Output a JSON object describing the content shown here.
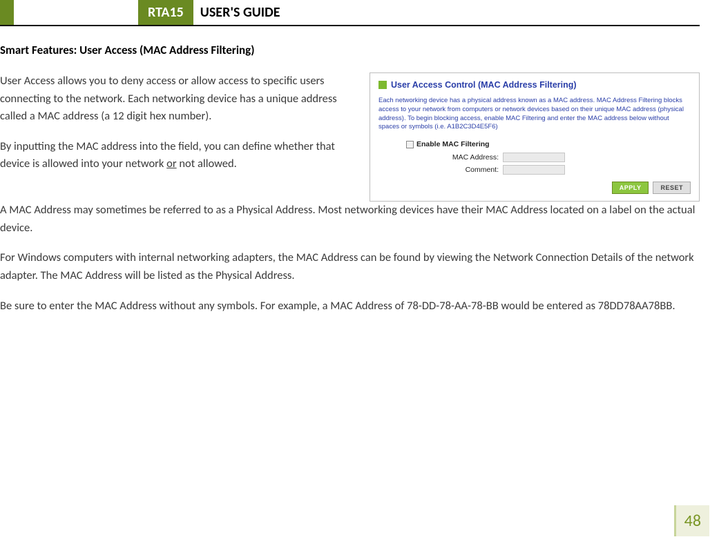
{
  "header": {
    "badge": "RTA15",
    "title": "USER'S GUIDE"
  },
  "section_title": "Smart Features: User Access (MAC Address Filtering)",
  "paragraphs": {
    "p1": "User Access allows you to deny access or allow access to specific users connecting to the network.  Each networking device has a unique address called a MAC address (a 12 digit hex number).",
    "p2a": "By inputting the MAC address into the field, you can define whether that device is allowed into your network ",
    "p2b": "or",
    "p2c": " not allowed.",
    "p3": "A MAC Address may sometimes be referred to as a Physical Address.  Most networking devices have their MAC Address located on a label on the actual device.",
    "p4": "For Windows computers with internal networking adapters, the MAC Address can be found by viewing the Network Connection Details of the network adapter.  The MAC Address will be listed as the Physical Address.",
    "p5": "Be sure to enter the MAC Address without any symbols.  For example, a MAC Address of 78-DD-78-AA-78-BB would be entered as 78DD78AA78BB."
  },
  "screenshot": {
    "title": "User Access Control (MAC Address Filtering)",
    "desc": "Each networking device has a physical address known as a MAC address. MAC Address Filtering blocks access to your network from computers or network devices based on their unique MAC address (physical address). To begin blocking access, enable MAC Filtering and enter the MAC address below without spaces or symbols (i.e. A1B2C3D4E5F6)",
    "enable_label": "Enable MAC Filtering",
    "mac_label": "MAC Address:",
    "comment_label": "Comment:",
    "apply": "APPLY",
    "reset": "RESET"
  },
  "page_number": "48"
}
